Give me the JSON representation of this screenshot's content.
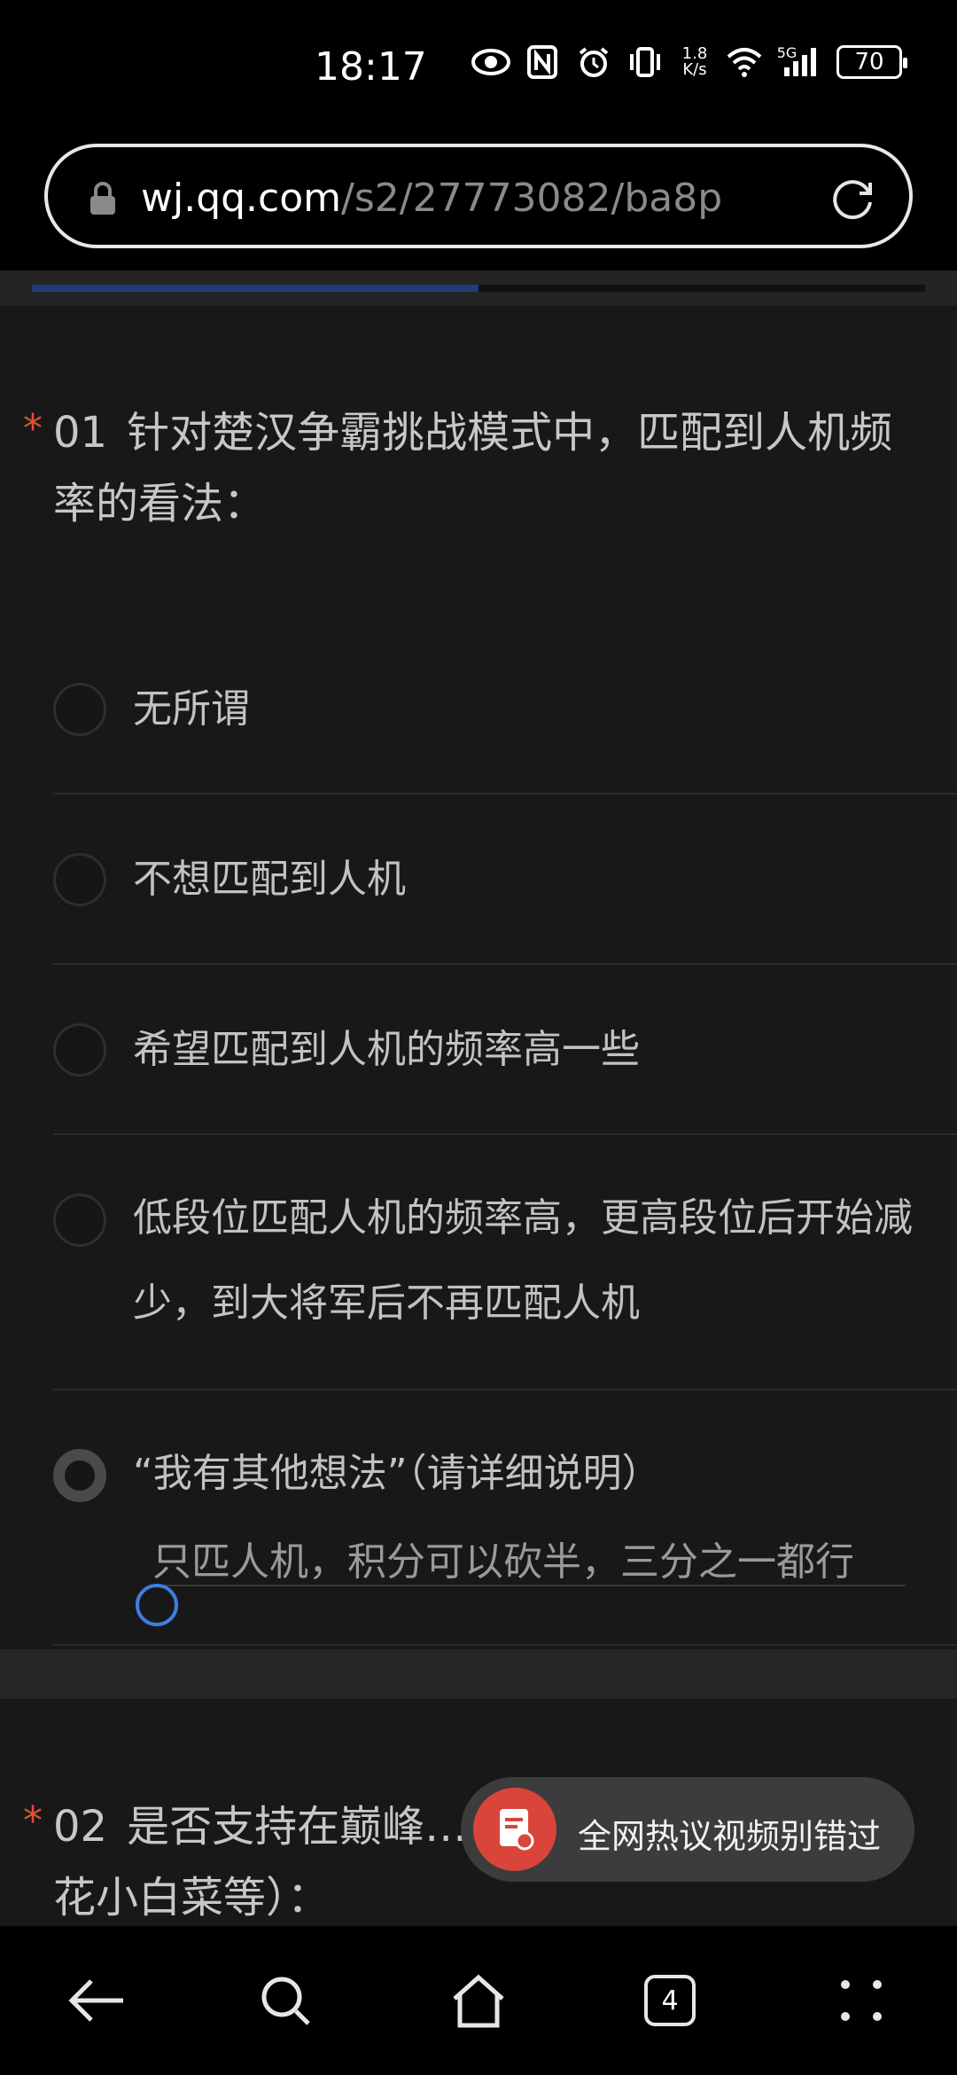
{
  "status_bar": {
    "time": "18:17",
    "net_speed_value": "1.8",
    "net_speed_unit": "K/s",
    "signal_label": "5G",
    "battery": "70"
  },
  "browser": {
    "url_host": "wj.qq.com",
    "url_path": "/s2/27773082/ba8p",
    "progress": 0.5
  },
  "question1": {
    "star": "*",
    "number": "01",
    "text": "针对楚汉争霸挑战模式中，匹配到人机频率的看法：",
    "options": [
      {
        "label": "无所谓",
        "selected": false
      },
      {
        "label": "不想匹配到人机",
        "selected": false
      },
      {
        "label": "希望匹配到人机的频率高一些",
        "selected": false
      },
      {
        "label": "低段位匹配人机的频率高，更高段位后开始减少，到大将军后不再匹配人机",
        "selected": false
      },
      {
        "label": "“我有其他想法”（请详细说明）",
        "selected": true
      }
    ],
    "other_input_value": "只匹人机，积分可以砍半，三分之一都行"
  },
  "question2": {
    "star": "*",
    "number": "02",
    "text": "是否支持在巅峰……礼功能（油菜花小白菜等）："
  },
  "toast": {
    "text": "全网热议视频别错过"
  },
  "bottom_nav": {
    "tab_count": "4"
  },
  "colors": {
    "accent_blue": "#3d7fe0",
    "required_star": "#e0503c",
    "toast_icon": "#d9453a"
  }
}
